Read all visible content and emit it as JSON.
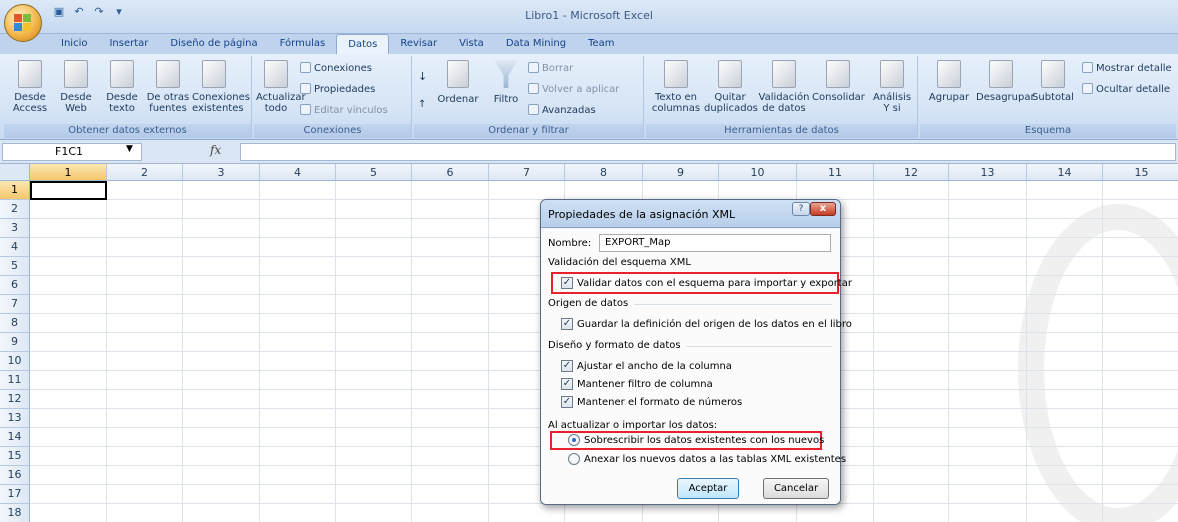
{
  "window": {
    "title": "Libro1 - Microsoft Excel"
  },
  "ribbon_tabs": [
    "Inicio",
    "Insertar",
    "Diseño de página",
    "Fórmulas",
    "Datos",
    "Revisar",
    "Vista",
    "Data Mining",
    "Team"
  ],
  "active_tab": "Datos",
  "ribbon": {
    "obtener": {
      "label": "Obtener datos externos",
      "buttons": [
        [
          "Desde",
          "Access"
        ],
        [
          "Desde",
          "Web"
        ],
        [
          "Desde",
          "texto"
        ],
        [
          "De otras",
          "fuentes"
        ],
        [
          "Conexiones",
          "existentes"
        ]
      ]
    },
    "conexiones": {
      "label": "Conexiones",
      "actualizar": [
        "Actualizar",
        "todo"
      ],
      "conexiones": "Conexiones",
      "propiedades": "Propiedades",
      "editar": "Editar vínculos"
    },
    "ordenar": {
      "label": "Ordenar y filtrar",
      "ordenar": "Ordenar",
      "filtro": "Filtro",
      "borrar": "Borrar",
      "volver": "Volver a aplicar",
      "avanzadas": "Avanzadas"
    },
    "herramientas": {
      "label": "Herramientas de datos",
      "buttons": [
        [
          "Texto en",
          "columnas"
        ],
        [
          "Quitar",
          "duplicados"
        ],
        [
          "Validación",
          "de datos"
        ],
        [
          "Consolidar",
          ""
        ],
        [
          "Análisis",
          "Y si"
        ]
      ]
    },
    "esquema": {
      "label": "Esquema",
      "buttons": [
        "Agrupar",
        "Desagrupar",
        "Subtotal"
      ],
      "mostrar": "Mostrar detalle",
      "ocultar": "Ocultar detalle"
    }
  },
  "formula_bar": {
    "name_box": "F1C1",
    "fx": "fx",
    "value": ""
  },
  "columns": [
    "1",
    "2",
    "3",
    "4",
    "5",
    "6",
    "7",
    "8",
    "9",
    "10",
    "11",
    "12",
    "13",
    "14",
    "15"
  ],
  "rows": [
    "1",
    "2",
    "3",
    "4",
    "5",
    "6",
    "7",
    "8",
    "9",
    "10",
    "11",
    "12",
    "13",
    "14",
    "15",
    "16",
    "17",
    "18"
  ],
  "dialog": {
    "title": "Propiedades de la asignación XML",
    "help": "?",
    "close": "x",
    "name_label": "Nombre:",
    "name_value": "EXPORT_Map",
    "section_validation": "Validación del esquema XML",
    "validate": "Validar datos con el esquema para importar y exportar",
    "section_origin": "Origen de datos",
    "save_definition": "Guardar la definición del origen de los datos en el libro",
    "section_format": "Diseño y formato de datos",
    "adjust_width": "Ajustar el ancho de la columna",
    "keep_filter": "Mantener filtro de columna",
    "keep_number_format": "Mantener el formato de números",
    "section_refresh": "Al actualizar o importar los datos:",
    "overwrite": "Sobrescribir los datos existentes con los nuevos",
    "append": "Anexar los nuevos datos a las tablas XML existentes",
    "ok": "Aceptar",
    "cancel": "Cancelar",
    "checked": {
      "validate": true,
      "save_definition": true,
      "adjust_width": true,
      "keep_filter": true,
      "keep_number_format": true
    },
    "selected_option": "overwrite"
  },
  "colors": {
    "highlight": "#e8212c",
    "ribbon": "#d4e3f5",
    "selected_header": "#f5c76c"
  }
}
